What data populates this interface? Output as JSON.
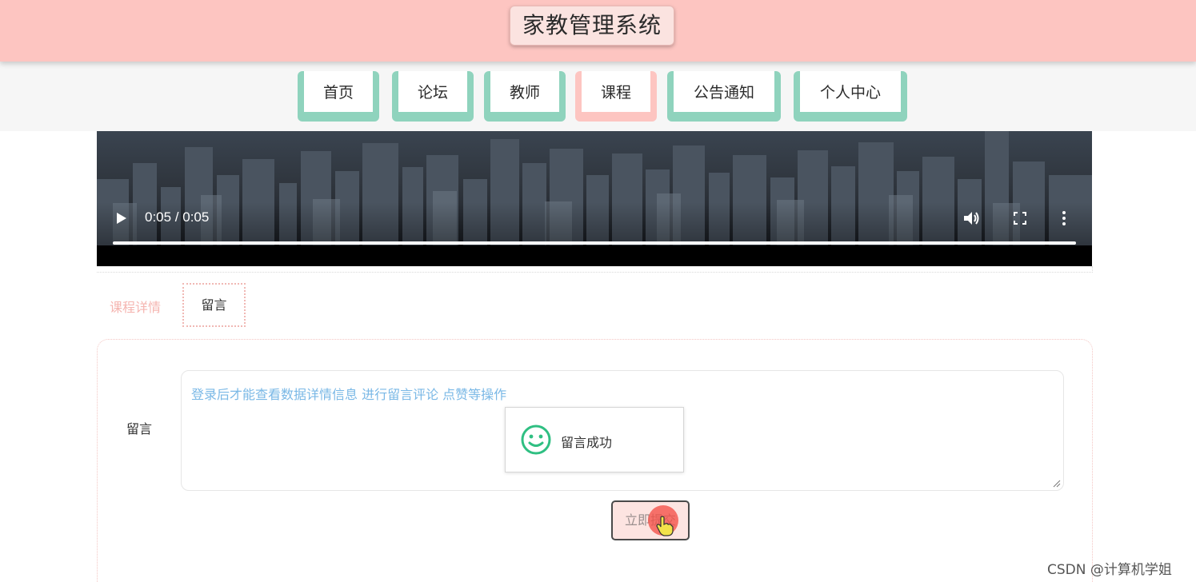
{
  "header": {
    "title": "家教管理系统"
  },
  "nav": {
    "items": [
      {
        "label": "首页",
        "active": false
      },
      {
        "label": "论坛",
        "active": false
      },
      {
        "label": "教师",
        "active": false
      },
      {
        "label": "课程",
        "active": true
      },
      {
        "label": "公告通知",
        "active": false
      },
      {
        "label": "个人中心",
        "active": false
      }
    ]
  },
  "video": {
    "time": "0:05 / 0:05",
    "progress": 1.0,
    "controls": [
      "play-icon",
      "volume-icon",
      "fullscreen-icon",
      "more-options-icon"
    ]
  },
  "tabs": {
    "details": "课程详情",
    "comment": "留言"
  },
  "comment_form": {
    "label": "留言",
    "placeholder": "登录后才能查看数据详情信息 进行留言评论 点赞等操作",
    "submit": "立即提交"
  },
  "toast": {
    "message": "留言成功",
    "icon": "smile-icon"
  },
  "watermark": "CSDN @计算机学姐",
  "colors": {
    "header_bg": "#fdc5c1",
    "nav_teal": "#8fd3bd",
    "nav_active": "#fdc5c1",
    "placeholder_blue": "#7ab8e6",
    "toast_green": "#2fbf82"
  }
}
